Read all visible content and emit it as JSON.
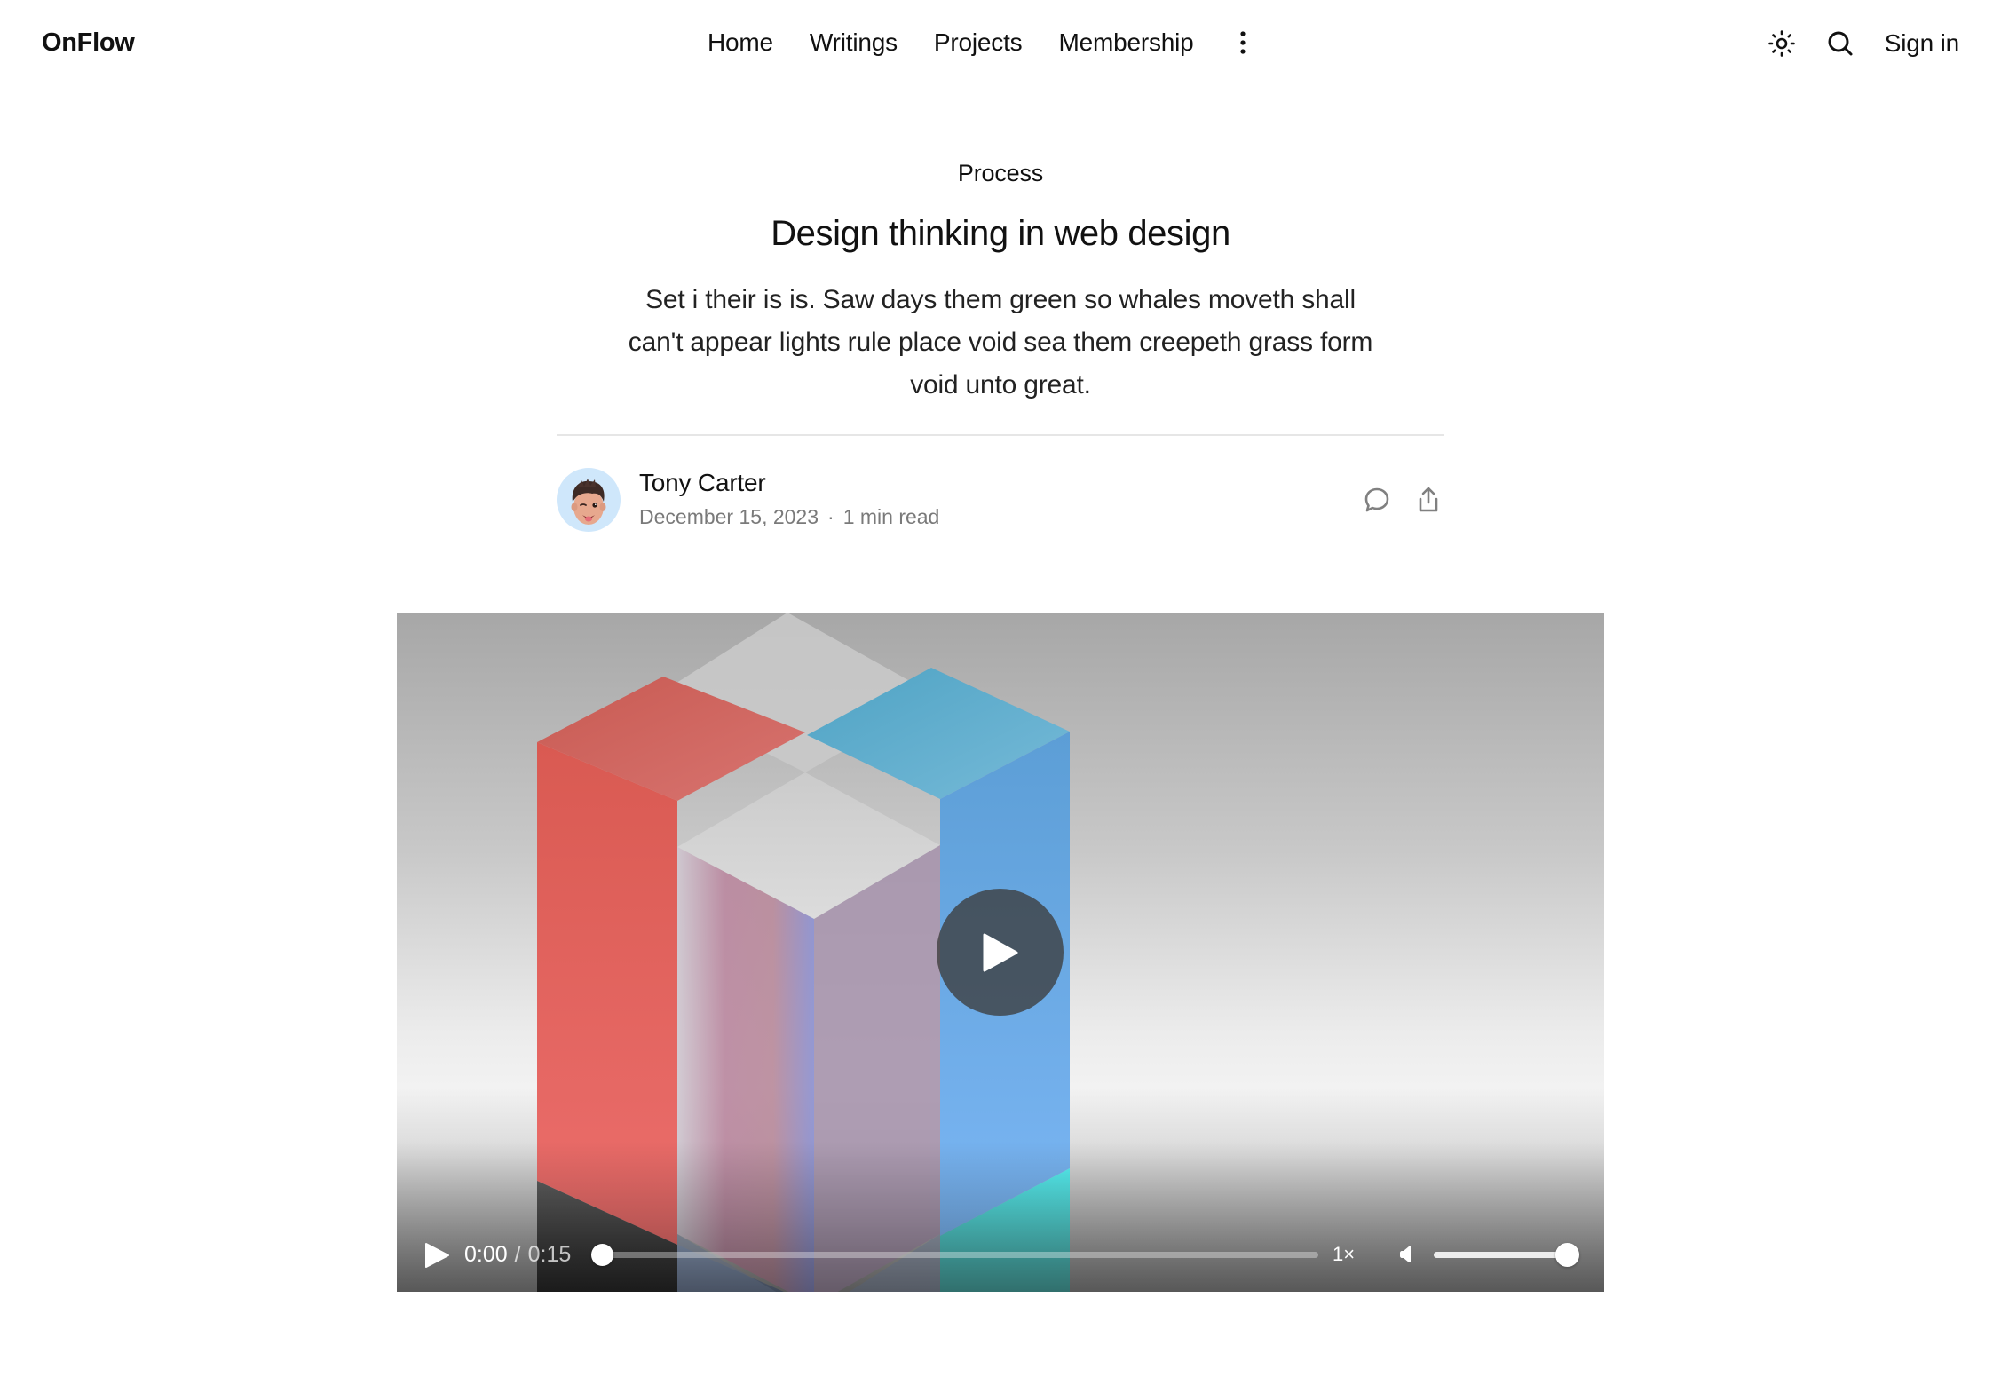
{
  "header": {
    "logo": "OnFlow",
    "nav": [
      {
        "label": "Home"
      },
      {
        "label": "Writings"
      },
      {
        "label": "Projects"
      },
      {
        "label": "Membership"
      }
    ],
    "more_icon": "more-vertical-icon",
    "theme_icon": "sun-icon",
    "search_icon": "search-icon",
    "sign_in": "Sign in"
  },
  "article": {
    "category": "Process",
    "title": "Design thinking in web design",
    "excerpt": "Set i their is is. Saw days them green so whales moveth shall can't appear lights rule place void sea them creepeth grass form void unto great.",
    "author": {
      "name": "Tony Carter",
      "date": "December 15, 2023",
      "separator": "·",
      "read_time": "1 min read",
      "avatar_bg": "#cfe7fb"
    },
    "actions": [
      {
        "icon": "comment-icon"
      },
      {
        "icon": "share-icon"
      }
    ]
  },
  "video": {
    "current_time": "0:00",
    "time_separator": "/",
    "duration": "0:15",
    "progress_fraction": 0,
    "speed": "1×",
    "volume_fraction": 1,
    "colors": {
      "red": "#e2605a",
      "blue": "#5fa6e0",
      "cyan": "#6ef0ee",
      "dark": "#3c3c3c",
      "glass": "#c9c4d2"
    }
  }
}
